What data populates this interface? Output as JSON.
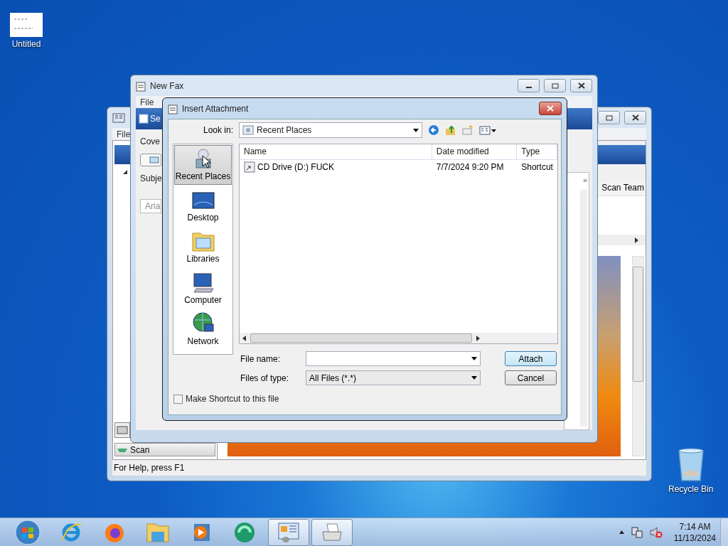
{
  "desktop_icons": [
    {
      "kind": "document",
      "label": "Untitled"
    },
    {
      "kind": "recycle-bin",
      "label": "Recycle Bin"
    }
  ],
  "fax_console": {
    "menu": [
      "File"
    ],
    "column_header": "Scan Team",
    "scan_button": "Scan",
    "status_bar": "For Help, press F1"
  },
  "new_fax": {
    "title": "New Fax",
    "menu": [
      "File"
    ],
    "send_button": "Se",
    "cover_label": "Cove",
    "subject_label": "Subje",
    "font_field": "Aria",
    "overflow_glyph": "»"
  },
  "dialog": {
    "title": "Insert Attachment",
    "look_in_label": "Look in:",
    "look_in_value": "Recent Places",
    "places": [
      {
        "kind": "recent",
        "label": "Recent Places",
        "selected": true
      },
      {
        "kind": "desktop",
        "label": "Desktop",
        "selected": false
      },
      {
        "kind": "libraries",
        "label": "Libraries",
        "selected": false
      },
      {
        "kind": "computer",
        "label": "Computer",
        "selected": false
      },
      {
        "kind": "network",
        "label": "Network",
        "selected": false
      }
    ],
    "columns": [
      "Name",
      "Date modified",
      "Type"
    ],
    "files": [
      {
        "name": "CD Drive (D:) FUCK",
        "date": "7/7/2024 9:20 PM",
        "type": "Shortcut"
      }
    ],
    "file_name_label": "File name:",
    "file_type_label": "Files of type:",
    "file_type_value": "All Files (*.*)",
    "buttons": [
      "Attach",
      "Cancel"
    ],
    "shortcut_checkbox": {
      "label": "Make Shortcut to this file",
      "checked": false
    }
  },
  "taskbar": {
    "apps": [
      {
        "kind": "start",
        "active": false
      },
      {
        "kind": "browser-e",
        "active": false
      },
      {
        "kind": "fox",
        "active": false
      },
      {
        "kind": "folder",
        "active": false
      },
      {
        "kind": "player",
        "active": false
      },
      {
        "kind": "green",
        "active": false
      },
      {
        "kind": "fax-console",
        "active": true
      },
      {
        "kind": "fax",
        "active": true
      }
    ],
    "time": "7:14 AM",
    "date": "11/13/2024"
  }
}
